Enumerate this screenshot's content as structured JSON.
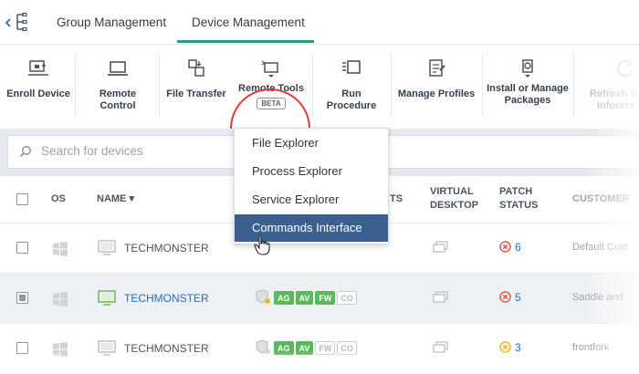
{
  "tabs": [
    {
      "label": "Group Management"
    },
    {
      "label": "Device Management"
    }
  ],
  "toolbar": {
    "enroll_device": "Enroll Device",
    "remote_control": "Remote Control",
    "file_transfer": "File Transfer",
    "remote_tools": "Remote Tools",
    "beta": "BETA",
    "run_procedure": "Run Procedure",
    "manage_profiles": "Manage Profiles",
    "install_manage_line1": "Install or Manage",
    "install_manage_line2": "Packages",
    "refresh_line1": "Refresh D",
    "refresh_line2": "Informa"
  },
  "search": {
    "placeholder": "Search for devices"
  },
  "table": {
    "headers": {
      "os": "OS",
      "name": "NAME",
      "name_sort": "▾",
      "agents_suffix": "TS",
      "virtual_desktop_line1": "VIRTUAL",
      "virtual_desktop_line2": "DESKTOP",
      "patch_status_line1": "PATCH",
      "patch_status_line2": "STATUS",
      "customer": "CUSTOMER"
    },
    "rows": [
      {
        "name": "TECHMONSTER",
        "patch_count": "6",
        "customer": "Default Cust"
      },
      {
        "name": "TECHMONSTER",
        "patch_count": "5",
        "customer": "Saddle and"
      },
      {
        "name": "TECHMONSTER",
        "patch_count": "3",
        "customer": "frontfork"
      }
    ],
    "badge_labels": {
      "ag": "AG",
      "av": "AV",
      "fw": "FW",
      "co": "CO"
    }
  },
  "dropdown": {
    "items": [
      {
        "label": "File Explorer"
      },
      {
        "label": "Process Explorer"
      },
      {
        "label": "Service Explorer"
      },
      {
        "label": "Commands Interface"
      }
    ]
  },
  "colors": {
    "accent_teal": "#2e9a87",
    "dropdown_active": "#3b5f8f",
    "badge_green": "#5cb85c",
    "highlight_circle": "#e53935"
  }
}
